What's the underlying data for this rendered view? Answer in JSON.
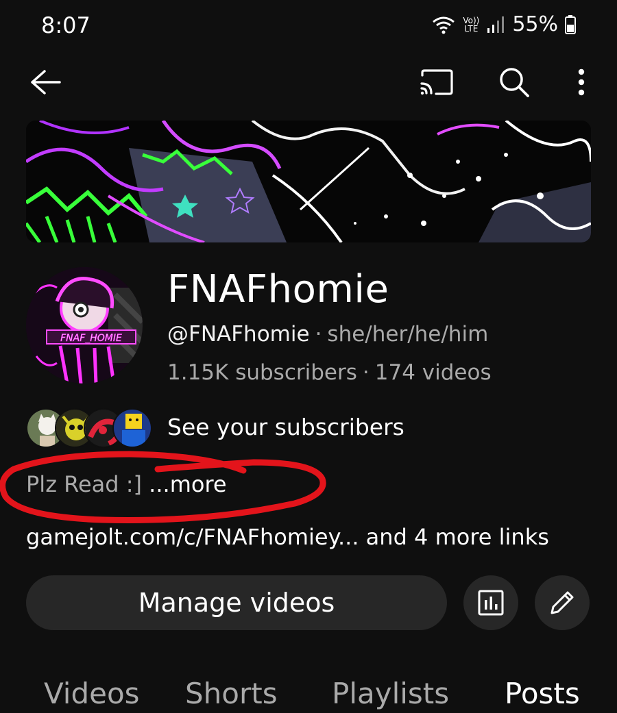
{
  "status_bar": {
    "time": "8:07",
    "network_top": "Vo))",
    "network_bottom": "LTE",
    "battery": "55%"
  },
  "app_bar": {
    "back_icon": "arrow-left-icon",
    "cast_icon": "cast-icon",
    "search_icon": "search-icon",
    "more_icon": "more-vertical-icon"
  },
  "channel": {
    "name": "FNAFhomie",
    "handle": "@FNAFhomie",
    "pronouns": "she/her/he/him",
    "subscribers": "1.15K subscribers",
    "videos": "174 videos",
    "avatar_text": "FNAF_HOMIE",
    "subscribers_link": "See your subscribers",
    "description": "Plz Read :]",
    "description_more": "...more",
    "link_main": "gamejolt.com/c/FNAFhomiey...",
    "link_more": "and 4 more links"
  },
  "actions": {
    "manage_videos": "Manage videos",
    "analytics_icon": "analytics-icon",
    "edit_icon": "pencil-icon"
  },
  "tabs": [
    {
      "label": "Videos",
      "active": false
    },
    {
      "label": "Shorts",
      "active": false
    },
    {
      "label": "Playlists",
      "active": false
    },
    {
      "label": "Posts",
      "active": true
    }
  ],
  "colors": {
    "background": "#0f0f0f",
    "button": "#272727",
    "secondary_text": "#aaaaaa",
    "annotation_red": "#e3141b"
  }
}
